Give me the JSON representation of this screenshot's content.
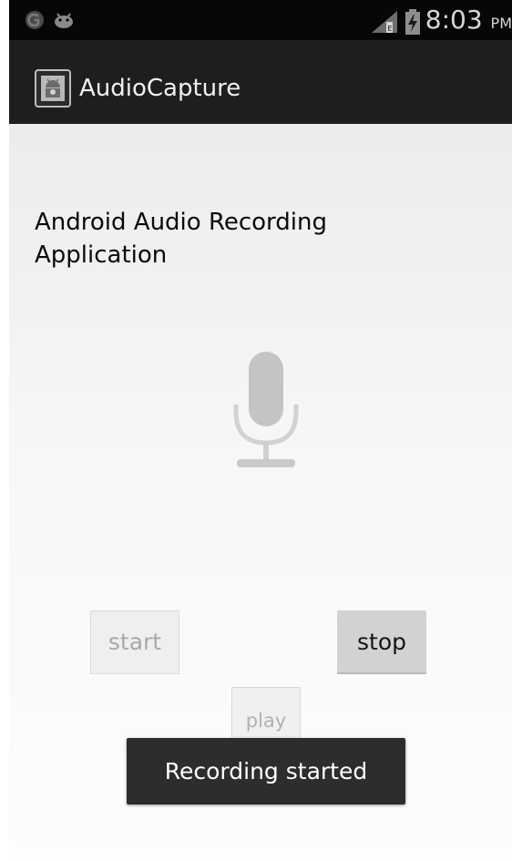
{
  "status_bar": {
    "time": "8:03",
    "ampm": "PM",
    "icons": [
      "notification-shield-icon",
      "notification-android-icon",
      "signal-icon",
      "battery-charging-icon"
    ]
  },
  "action_bar": {
    "title": "AudioCapture",
    "icon": "android-app-icon"
  },
  "main": {
    "heading": "Android Audio Recording Application",
    "illustration_icon": "microphone-icon",
    "buttons": {
      "start": {
        "label": "start",
        "enabled": false
      },
      "stop": {
        "label": "stop",
        "enabled": true
      },
      "play": {
        "label": "play",
        "enabled": false
      }
    }
  },
  "toast": {
    "message": "Recording started"
  },
  "colors": {
    "status_bar_bg": "#070707",
    "action_bar_bg": "#1e1e1e",
    "toast_bg": "#2d2d2d",
    "disabled_text": "#a9a9a9",
    "button_bg": "#d2d2d2"
  }
}
